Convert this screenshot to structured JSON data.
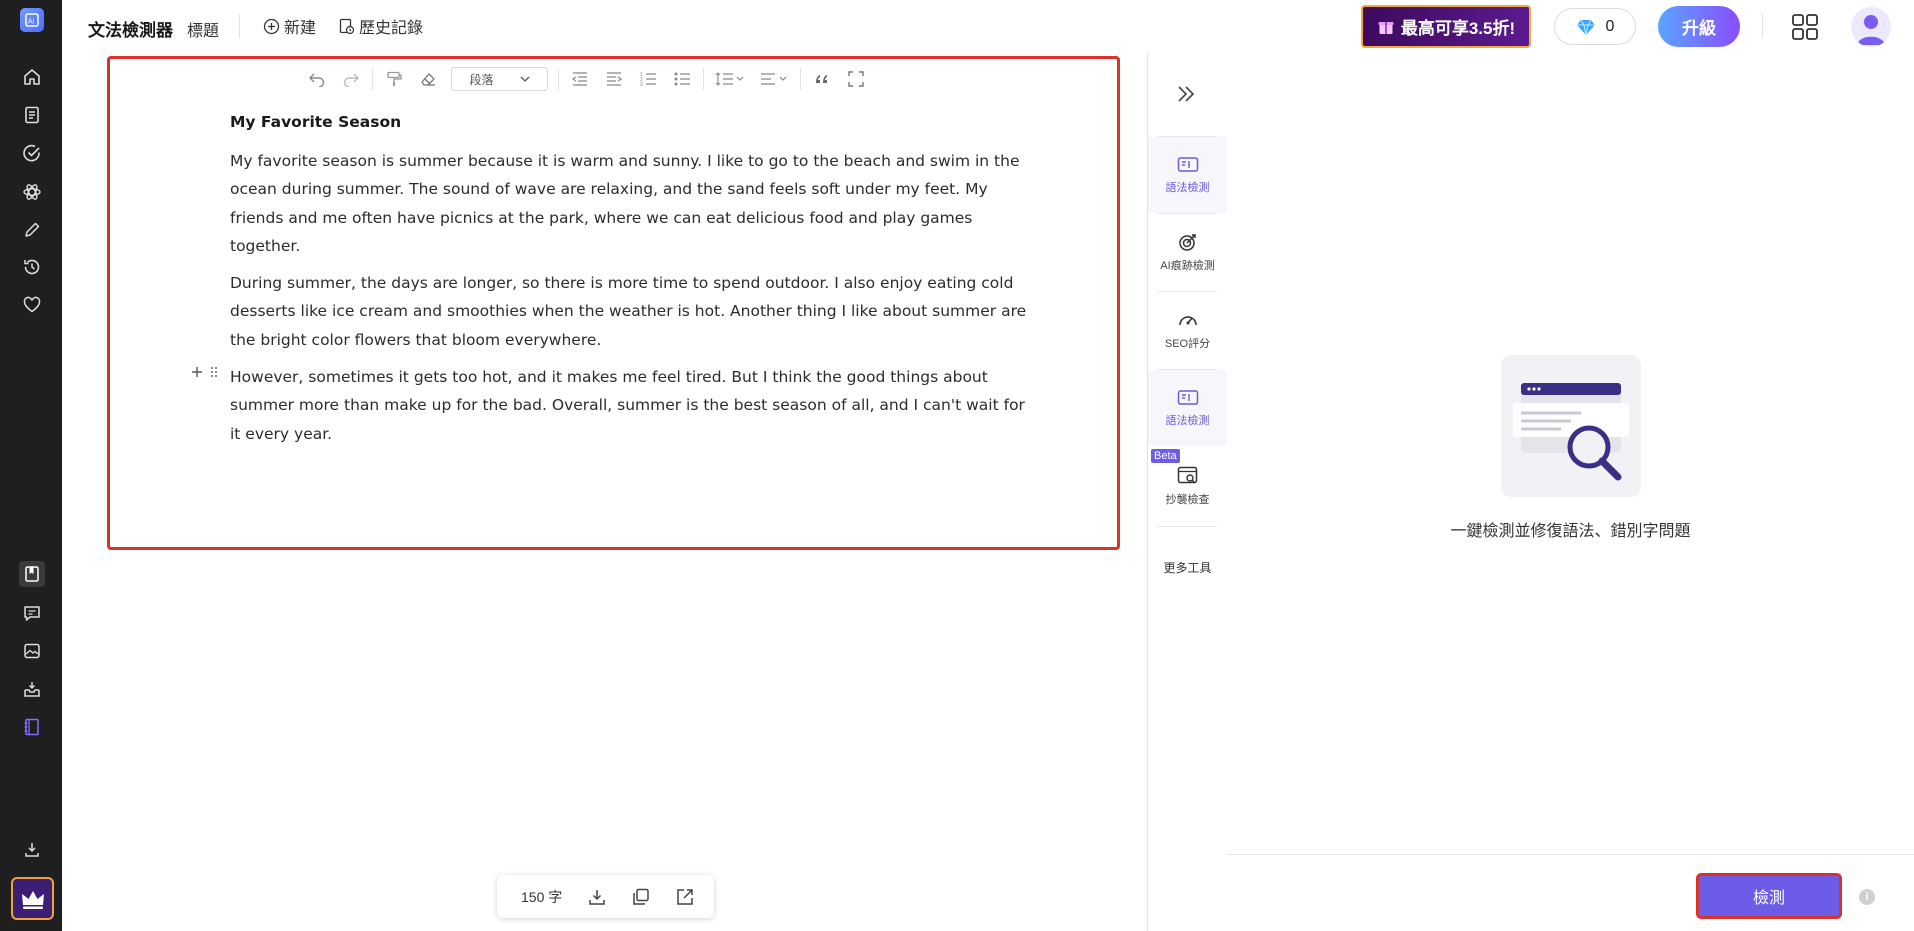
{
  "header": {
    "app_title": "文法檢測器",
    "doc_title": "標題",
    "new_label": "新建",
    "history_label": "歷史記錄",
    "promo_label": "最高可享3.5折!",
    "gem_count": "0",
    "upgrade_label": "升級"
  },
  "toolbar": {
    "paragraph_select": "段落"
  },
  "document": {
    "heading": "My Favorite Season",
    "paragraphs": [
      "My favorite season is summer because it is warm and sunny. I like to go to the beach and swim in the ocean during summer. The sound of wave are relaxing, and the sand feels soft under my feet. My friends and me often have picnics at the park, where we can eat delicious food and play games together.",
      "During summer, the days are longer, so there is more time to spend outdoor. I also enjoy eating cold desserts like ice cream and smoothies when the weather is hot. Another thing I like about summer are the bright color flowers that bloom everywhere.",
      "However, sometimes it gets too hot, and it makes me feel tired. But I think the good things about summer more than make up for the bad. Overall, summer is the best season of all, and I can't wait for it every year."
    ]
  },
  "count_bar": {
    "word_count": "150 字"
  },
  "tools": {
    "items": [
      {
        "label": "語法檢測",
        "icon": "grammar-check-icon"
      },
      {
        "label": "AI痕跡檢測",
        "icon": "ai-detect-icon"
      },
      {
        "label": "SEO評分",
        "icon": "seo-gauge-icon"
      },
      {
        "label": "語法檢測",
        "icon": "grammar-check-icon"
      },
      {
        "label": "抄襲檢查",
        "icon": "plagiarism-icon"
      }
    ],
    "beta_badge": "Beta",
    "more_label": "更多工具"
  },
  "panel": {
    "empty_text": "一鍵檢測並修復語法、錯別字問題",
    "detect_label": "檢測",
    "info_glyph": "i"
  },
  "colors": {
    "accent": "#6c5ce7",
    "highlight_border": "#d7332b",
    "rail_bg": "#1f1f1f"
  }
}
